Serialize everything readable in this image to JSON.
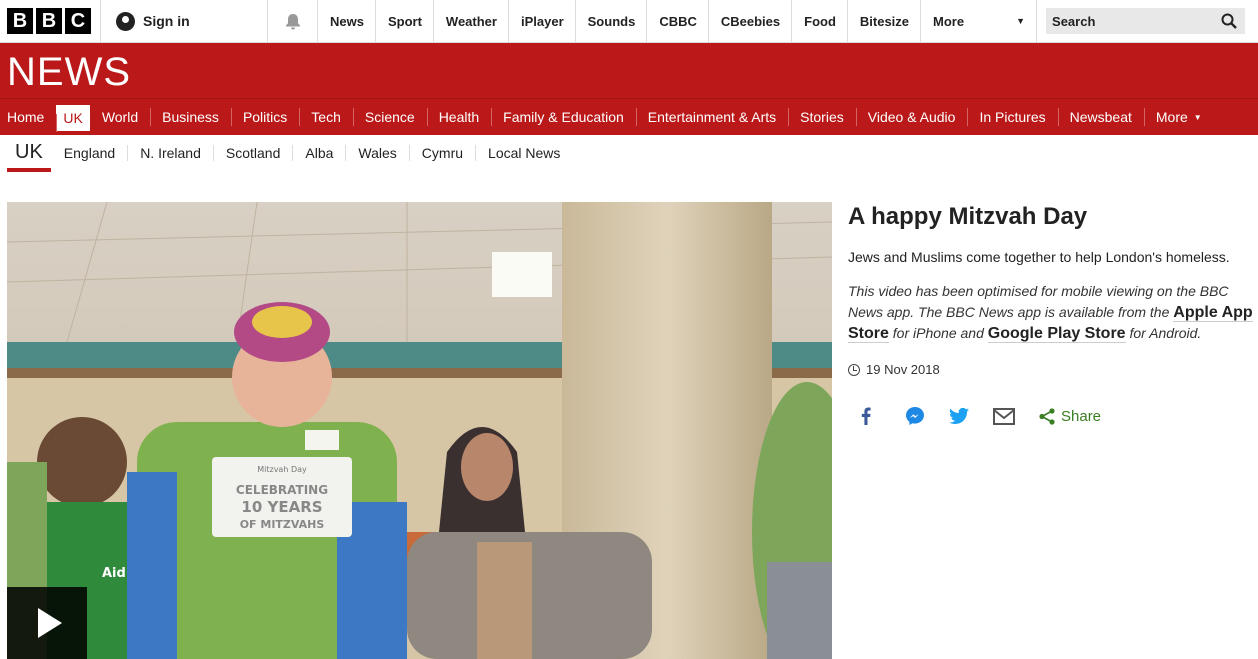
{
  "top_bar": {
    "logo_letters": [
      "B",
      "B",
      "C"
    ],
    "sign_in": "Sign in",
    "nav": [
      "News",
      "Sport",
      "Weather",
      "iPlayer",
      "Sounds",
      "CBBC",
      "CBeebies",
      "Food",
      "Bitesize"
    ],
    "more": "More",
    "search": "Search"
  },
  "banner": {
    "wordmark": "NEWS",
    "color": "#bb1919"
  },
  "section_nav": {
    "items": [
      "Home",
      "UK",
      "World",
      "Business",
      "Politics",
      "Tech",
      "Science",
      "Health",
      "Family & Education",
      "Entertainment & Arts",
      "Stories",
      "Video & Audio",
      "In Pictures",
      "Newsbeat",
      "More"
    ],
    "active": "UK"
  },
  "sub_nav": {
    "current": "UK",
    "items": [
      "England",
      "N. Ireland",
      "Scotland",
      "Alba",
      "Wales",
      "Cymru",
      "Local News"
    ]
  },
  "article": {
    "title": "A happy Mitzvah Day",
    "summary": "Jews and Muslims come together to help London's homeless.",
    "note_1": "This video has been optimised for mobile viewing on the BBC News app. The BBC News app is available from the ",
    "apple_store": "Apple App Store",
    "note_2": " for iPhone and ",
    "google_store": "Google Play Store",
    "note_3": " for Android.",
    "date": "19 Nov 2018",
    "share_label": "Share",
    "share_icons": [
      "facebook-icon",
      "messenger-icon",
      "twitter-icon",
      "email-icon"
    ],
    "video_shirt_text": [
      "Mitzvah Day",
      "CELEBRATING",
      "10 YEARS",
      "OF MITZVAHS"
    ],
    "video_badge": "Aid"
  }
}
